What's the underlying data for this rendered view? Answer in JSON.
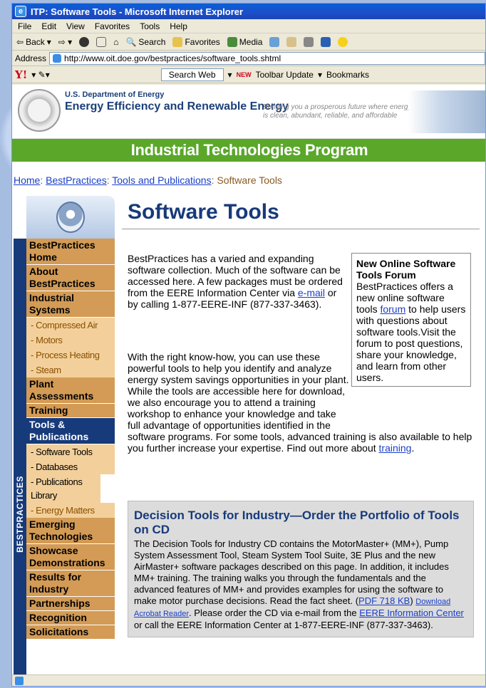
{
  "window": {
    "title": "ITP: Software Tools - Microsoft Internet Explorer"
  },
  "menu": [
    "File",
    "Edit",
    "View",
    "Favorites",
    "Tools",
    "Help"
  ],
  "toolbar": {
    "back": "Back",
    "search": "Search",
    "favorites": "Favorites",
    "media": "Media"
  },
  "address": {
    "label": "Address",
    "url": "http://www.oit.doe.gov/bestpractices/software_tools.shtml"
  },
  "yahoo": {
    "search_button": "Search Web",
    "new_badge": "NEW",
    "toolbar_update": "Toolbar Update",
    "bookmarks": "Bookmarks"
  },
  "header": {
    "department": "U.S. Department of Energy",
    "office": "Energy Efficiency and Renewable Energy",
    "tagline": "Bringing you a prosperous future where energy is clean, abundant, reliable, and affordable",
    "program": "Industrial Technologies Program"
  },
  "breadcrumb": {
    "home": "Home",
    "bp": "BestPractices",
    "tp": "Tools and Publications",
    "current": "Software Tools"
  },
  "sidebar": {
    "vertical_label": "BESTPRACTICES",
    "items": [
      {
        "label": "BestPractices Home"
      },
      {
        "label": "About BestPractices"
      },
      {
        "label": "Industrial Systems"
      },
      {
        "label": "- Compressed Air"
      },
      {
        "label": "- Motors"
      },
      {
        "label": "- Process Heating"
      },
      {
        "label": "- Steam"
      },
      {
        "label": "Plant Assessments"
      },
      {
        "label": "Training"
      },
      {
        "label": "Tools & Publications"
      },
      {
        "label": "- Software Tools"
      },
      {
        "label": "- Databases"
      },
      {
        "label": "- Publications Library"
      },
      {
        "label": "- Energy Matters"
      },
      {
        "label": "Emerging Technologies"
      },
      {
        "label": "Showcase Demonstrations"
      },
      {
        "label": "Results for Industry"
      },
      {
        "label": "Partnerships"
      },
      {
        "label": "Recognition"
      },
      {
        "label": "Solicitations"
      }
    ]
  },
  "main": {
    "title": "Software Tools",
    "intro_a": "BestPractices has a varied and expanding software collection. Much of the software can be accessed here. A few packages must be ordered from the EERE Information Center via ",
    "intro_link": "e-mail",
    "intro_b": " or by calling 1-877-EERE-INF (877-337-3463).",
    "para2_a": "With the right know-how, you can use these powerful tools to help you identify and analyze energy system savings opportunities in your plant. While the tools are accessible here for download, we also encourage you to attend a training workshop to enhance your knowledge and take full advantage of opportunities identified in the software programs. For some tools, advanced training is also available to help you further increase your expertise. Find out more about ",
    "para2_link": "training",
    "para2_b": ".",
    "forum": {
      "title": "New Online Software Tools Forum",
      "text_a": "BestPractices offers a new online software tools ",
      "link": "forum",
      "text_b": " to help users with questions about software tools.Visit the forum to post questions, share your knowledge, and learn from other users."
    },
    "decision": {
      "title": "Decision Tools for Industry—Order the Portfolio of Tools on CD",
      "text_a": "The Decision Tools for Industry CD contains the MotorMaster+ (MM+), Pump System Assessment Tool, Steam System Tool Suite, 3E Plus and the new AirMaster+ software packages described on this page. In addition, it includes MM+ training. The training walks you through the fundamentals and the advanced features of MM+ and provides examples for using the software to make motor purchase decisions. Read the fact sheet. (",
      "pdf_link": "PDF 718 KB",
      "text_b": ") ",
      "acrobat_link": "Download Acrobat Reader",
      "text_c": ". Please order the CD via e-mail from the ",
      "eere_link": "EERE Information Center",
      "text_d": " or call the EERE Information Center at 1-877-EERE-INF (877-337-3463)."
    }
  }
}
